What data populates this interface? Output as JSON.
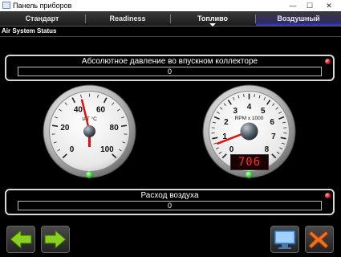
{
  "window": {
    "title": "Панель приборов",
    "minimize": "—",
    "maximize": "☐",
    "close": "✕"
  },
  "tabs": [
    {
      "label": "Стандарт"
    },
    {
      "label": "Readiness"
    },
    {
      "label": "Топливо"
    },
    {
      "label": "Воздушный"
    }
  ],
  "section": {
    "title": "Air System Status"
  },
  "panels": {
    "pressure": {
      "label": "Абсолютное давление во впускном коллекторе",
      "value": "0"
    },
    "airflow": {
      "label": "Расход воздуха",
      "value": "0"
    }
  },
  "gauges": {
    "iat": {
      "unit": "IAT °C",
      "ticks": [
        "0",
        "20",
        "40",
        "60",
        "80",
        "100"
      ],
      "value": 45
    },
    "rpm": {
      "unit": "RPM x 1000",
      "ticks": [
        "0",
        "1",
        "2",
        "3",
        "4",
        "5",
        "6",
        "7",
        "8"
      ],
      "value": 0.706,
      "display": "706"
    }
  },
  "colors": {
    "needle": "#e01010",
    "led_ok": "#30c030",
    "alert": "#d01010",
    "tab_selected": "#3a3ad0"
  },
  "icons": [
    "back-arrow-icon",
    "forward-arrow-icon",
    "monitor-icon",
    "close-x-icon"
  ]
}
